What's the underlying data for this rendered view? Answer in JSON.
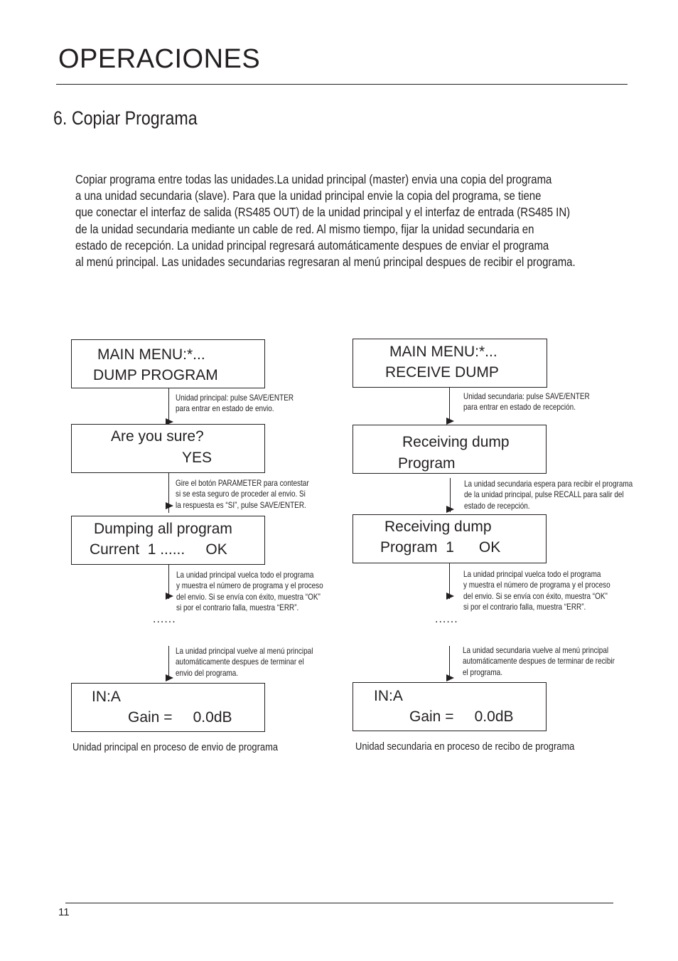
{
  "header": {
    "title": "OPERACIONES"
  },
  "section": {
    "title": "6. Copiar Programa"
  },
  "intro": {
    "lines": [
      "Copiar programa entre todas las unidades.La unidad principal (master) envia una copia del programa",
      "a una unidad secundaria (slave). Para que la unidad principal envie la copia del programa, se tiene",
      "que conectar el interfaz de salida (RS485 OUT) de la unidad principal y el interfaz de entrada (RS485 IN)",
      "de la unidad secundaria mediante un cable de red. Al mismo tiempo, fijar la unidad secundaria en",
      "estado de recepción. La unidad principal regresará automáticamente despues de enviar el programa",
      "al menú principal. Las unidades secundarias regresaran al menú principal despues de recibir el programa."
    ]
  },
  "master": {
    "screens": [
      {
        "line1": "MAIN MENU:*...",
        "line2": "DUMP PROGRAM"
      },
      {
        "line1": "Are you sure?",
        "line2": "YES"
      },
      {
        "line1": "Dumping all program",
        "line2": "Current  1 ......     OK"
      },
      {
        "line1": "IN:A",
        "line2": "Gain =     0.0dB"
      }
    ],
    "notes": [
      [
        "Unidad principal: pulse SAVE/ENTER",
        "para entrar en estado de envio."
      ],
      [
        "Gire el botón PARAMETER para contestar",
        "si se esta seguro de proceder al envio. Si",
        "la respuesta es “SI”, pulse SAVE/ENTER."
      ],
      [
        "La unidad principal vuelca todo el programa",
        "y muestra el número de programa y el proceso",
        "del envio. Si se envía con éxito, muestra “OK”",
        "si por el contrario falla, muestra “ERR”."
      ],
      [
        "La unidad principal vuelve al menú principal",
        "automáticamente despues de terminar el",
        "envio del programa."
      ]
    ],
    "ellipsis": "......",
    "caption": "Unidad principal en proceso de envio de programa"
  },
  "slave": {
    "screens": [
      {
        "line1": "MAIN MENU:*...",
        "line2": "RECEIVE DUMP"
      },
      {
        "line1": "Receiving dump",
        "line2": "Program"
      },
      {
        "line1": "Receiving dump",
        "line2": "Program  1      OK"
      },
      {
        "line1": "IN:A",
        "line2": "Gain =     0.0dB"
      }
    ],
    "notes": [
      [
        "Unidad secundaria: pulse SAVE/ENTER",
        "para entrar en estado de recepción."
      ],
      [
        "La unidad secundaria espera para recibir el programa",
        "de la unidad principal, pulse RECALL para salir del",
        "estado de recepción."
      ],
      [
        "La unidad principal vuelca todo el programa",
        "y muestra el número de programa y el proceso",
        "del envio. Si se envía con éxito, muestra “OK”",
        "si por el contrario falla, muestra “ERR”."
      ],
      [
        "La unidad secundaria vuelve al menú principal",
        "automáticamente despues de terminar de recibir",
        "el programa."
      ]
    ],
    "ellipsis": "......",
    "caption": "Unidad secundaria en proceso de recibo de programa"
  },
  "footer": {
    "page_number": "11"
  }
}
